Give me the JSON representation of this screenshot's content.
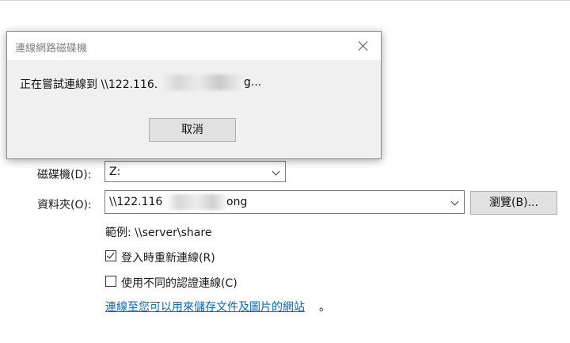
{
  "dialog": {
    "title": "連線網路磁碟機",
    "message": "正在嘗試連線到 \\\\122.116.",
    "message_suffix": "g...",
    "cancel_label": "取消"
  },
  "wizard": {
    "drive_label": "磁碟機(D):",
    "drive_value": "Z:",
    "folder_label": "資料夾(O):",
    "folder_value_prefix": "\\\\122.116",
    "folder_value_suffix": "ong",
    "browse_label": "瀏覽(B)...",
    "example_text": "範例: \\\\server\\share",
    "reconnect_label": "登入時重新連線(R)",
    "reconnect_checked": true,
    "credentials_label": "使用不同的認證連線(C)",
    "credentials_checked": false,
    "link_text": "連線至您可以用來儲存文件及圖片的網站",
    "link_suffix": "。"
  }
}
